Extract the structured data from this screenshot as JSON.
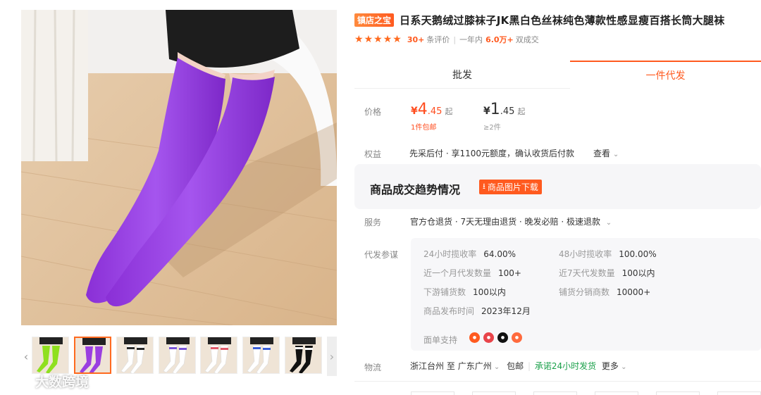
{
  "watermark": {
    "text": "大数跨境"
  },
  "thumbnails": {
    "prev_glyph": "‹",
    "next_glyph": "›",
    "items": [
      {
        "sock_color": "#8fe01f"
      },
      {
        "sock_color": "#9a3fe0",
        "active": true
      },
      {
        "sock_color": "#ffffff",
        "stripe": "#2a2a2a"
      },
      {
        "sock_color": "#ffffff",
        "stripe": "#7a55d8"
      },
      {
        "sock_color": "#ffffff",
        "stripe": "#e05a6a"
      },
      {
        "sock_color": "#ffffff",
        "stripe": "#3b5fd8"
      },
      {
        "sock_color": "#111111",
        "stripe": "#ffffff"
      }
    ]
  },
  "product": {
    "store_badge": "镇店之宝",
    "title": "日系天鹅绒过膝袜子JK黑白色丝袜纯色薄款性感显瘦百搭长筒大腿袜",
    "rating": {
      "stars": 5,
      "review_count": "30+",
      "review_label": "条评价",
      "sales_prefix": "一年内",
      "sales_count": "6.0万+",
      "sales_suffix": "双成交"
    }
  },
  "tabs": {
    "wholesale": "批发",
    "dropship": "一件代发"
  },
  "price": {
    "label": "价格",
    "tier1": {
      "currency": "¥",
      "int": "4",
      "dec": ".45",
      "unit": "起",
      "note": "1件包邮"
    },
    "tier2": {
      "currency": "¥",
      "int": "1",
      "dec": ".45",
      "unit": "起",
      "note": "≥2件"
    }
  },
  "benefit": {
    "label": "权益",
    "text": "先采后付 · 享1100元额度，确认收货后付款",
    "more": "查看"
  },
  "trend": {
    "title": "商品成交趋势情况",
    "download": "商品图片下载"
  },
  "service": {
    "label": "服务",
    "text": "官方仓退货 · 7天无理由退货 · 晚发必赔 · 极速退款"
  },
  "dropship_ref": {
    "label": "代发参谋",
    "stats": [
      {
        "k": "24小时揽收率",
        "v": "64.00%"
      },
      {
        "k": "48小时揽收率",
        "v": "100.00%"
      },
      {
        "k": "近一个月代发数量",
        "v": "100+"
      },
      {
        "k": "近7天代发数量",
        "v": "100以内"
      },
      {
        "k": "下游铺货数",
        "v": "100以内"
      },
      {
        "k": "铺货分销商数",
        "v": "10000+"
      },
      {
        "k": "商品发布时间",
        "v": "2023年12月"
      }
    ],
    "face_label": "面单支持",
    "platform_colors": [
      "#ff5a1f",
      "#e8444a",
      "#111111",
      "#ff6a3d"
    ]
  },
  "logistics": {
    "label": "物流",
    "from": "浙江台州",
    "to_word": "至",
    "to": "广东广州",
    "ship": "包邮",
    "promise": "承诺24小时发货",
    "more": "更多"
  }
}
